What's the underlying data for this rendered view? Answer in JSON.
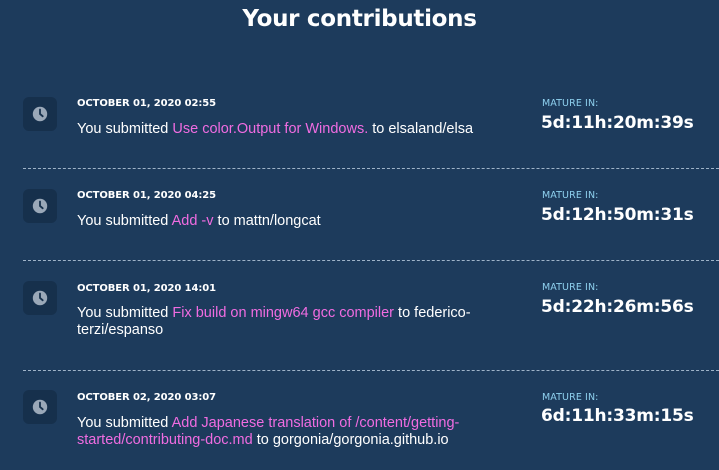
{
  "page": {
    "title": "Your contributions"
  },
  "contributions": [
    {
      "date": "OCTOBER 01, 2020 02:55",
      "prefix": "You submitted ",
      "link": "Use color.Output for Windows.",
      "suffix": " to elsaland/elsa",
      "mature_label": "MATURE IN:",
      "countdown": "5d:11h:20m:39s",
      "icon": "clock-icon"
    },
    {
      "date": "OCTOBER 01, 2020 04:25",
      "prefix": "You submitted ",
      "link": "Add -v",
      "suffix": " to mattn/longcat",
      "mature_label": "MATURE IN:",
      "countdown": "5d:12h:50m:31s",
      "icon": "clock-icon"
    },
    {
      "date": "OCTOBER 01, 2020 14:01",
      "prefix": "You submitted ",
      "link": "Fix build on mingw64 gcc compiler",
      "suffix": " to federico-terzi/espanso",
      "mature_label": "MATURE IN:",
      "countdown": "5d:22h:26m:56s",
      "icon": "clock-icon"
    },
    {
      "date": "OCTOBER 02, 2020 03:07",
      "prefix": "You submitted ",
      "link": "Add Japanese translation of /content/getting-started/contributing-doc.md",
      "suffix": " to gorgonia/gorgonia.github.io",
      "mature_label": "MATURE IN:",
      "countdown": "6d:11h:33m:15s",
      "icon": "clock-icon"
    }
  ],
  "colors": {
    "background": "#1d3b5c",
    "icon_box": "#16304c",
    "link": "#f06ce1",
    "label": "#8ed0ee",
    "text": "#ffffff"
  }
}
